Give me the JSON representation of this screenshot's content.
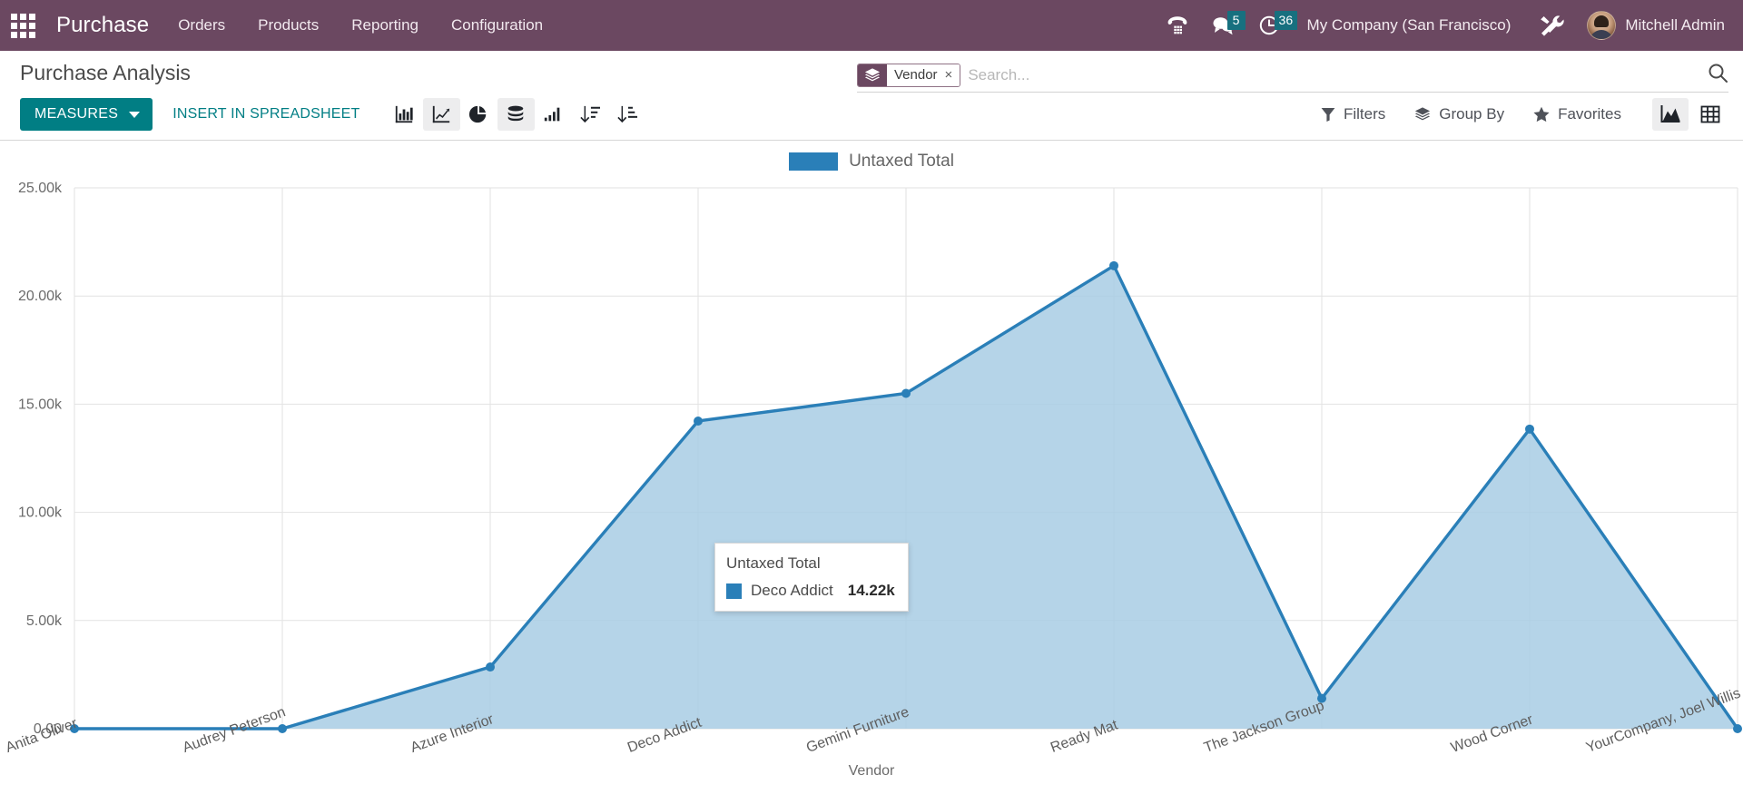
{
  "navbar": {
    "apps_icon": "apps-grid-icon",
    "brand": "Purchase",
    "menu": [
      {
        "label": "Orders"
      },
      {
        "label": "Products"
      },
      {
        "label": "Reporting"
      },
      {
        "label": "Configuration"
      }
    ],
    "voip_icon": "phone-dialpad-icon",
    "messages_icon": "messages-icon",
    "messages_count": "5",
    "activities_icon": "clock-activities-icon",
    "activities_count": "36",
    "company": "My Company (San Francisco)",
    "tools_icon": "developer-tools-icon",
    "avatar_icon": "user-avatar",
    "user": "Mitchell Admin",
    "bg_color": "#6b4861",
    "badge_color": "#17707f"
  },
  "control_panel": {
    "breadcrumb": "Purchase Analysis",
    "measures_label": "MEASURES",
    "spreadsheet_label": "INSERT IN SPREADSHEET",
    "accent_color": "#017e84",
    "chart_buttons": [
      {
        "name": "bar-chart-icon",
        "label": "Bar Chart",
        "active": false
      },
      {
        "name": "line-chart-icon",
        "label": "Line Chart",
        "active": true
      },
      {
        "name": "pie-chart-icon",
        "label": "Pie Chart",
        "active": false
      },
      {
        "name": "stacked-icon",
        "label": "Stacked",
        "active": true
      },
      {
        "name": "ascending-bars-icon",
        "label": "Cumulative",
        "active": false
      },
      {
        "name": "sort-descending-icon",
        "label": "Descending",
        "active": false
      },
      {
        "name": "sort-ascending-icon",
        "label": "Ascending",
        "active": false
      }
    ],
    "filters_label": "Filters",
    "groupby_label": "Group By",
    "favorites_label": "Favorites",
    "view_buttons": [
      {
        "name": "graph-view-icon",
        "label": "Graph",
        "active": true
      },
      {
        "name": "pivot-view-icon",
        "label": "Pivot",
        "active": false
      }
    ]
  },
  "search": {
    "facet_icon": "group-by-layers-icon",
    "facet_label": "Vendor",
    "facet_remove": "×",
    "placeholder": "Search...",
    "value": "",
    "search_icon": "search-icon"
  },
  "tooltip": {
    "title": "Untaxed Total",
    "series_name": "Deco Addict",
    "value": "14.22k",
    "swatch_color": "#2a7fb8"
  },
  "chart_data": {
    "type": "area",
    "title": "",
    "xlabel": "Vendor",
    "ylabel": "",
    "legend": [
      "Untaxed Total"
    ],
    "legend_position": "top",
    "grid": true,
    "line_color": "#2a7fb8",
    "fill_color": "#a8cde4",
    "ylim": [
      0,
      25000
    ],
    "yticks": [
      0,
      5000,
      10000,
      15000,
      20000,
      25000
    ],
    "ytick_labels": [
      "0.00",
      "5.00k",
      "10.00k",
      "15.00k",
      "20.00k",
      "25.00k"
    ],
    "categories": [
      "Anita Oliver",
      "Audrey Peterson",
      "Azure Interior",
      "Deco Addict",
      "Gemini Furniture",
      "Ready Mat",
      "The Jackson Group",
      "Wood Corner",
      "YourCompany, Joel Willis"
    ],
    "series": [
      {
        "name": "Untaxed Total",
        "values": [
          0,
          0,
          2850,
          14220,
          15500,
          21400,
          1400,
          13850,
          0
        ]
      }
    ]
  }
}
